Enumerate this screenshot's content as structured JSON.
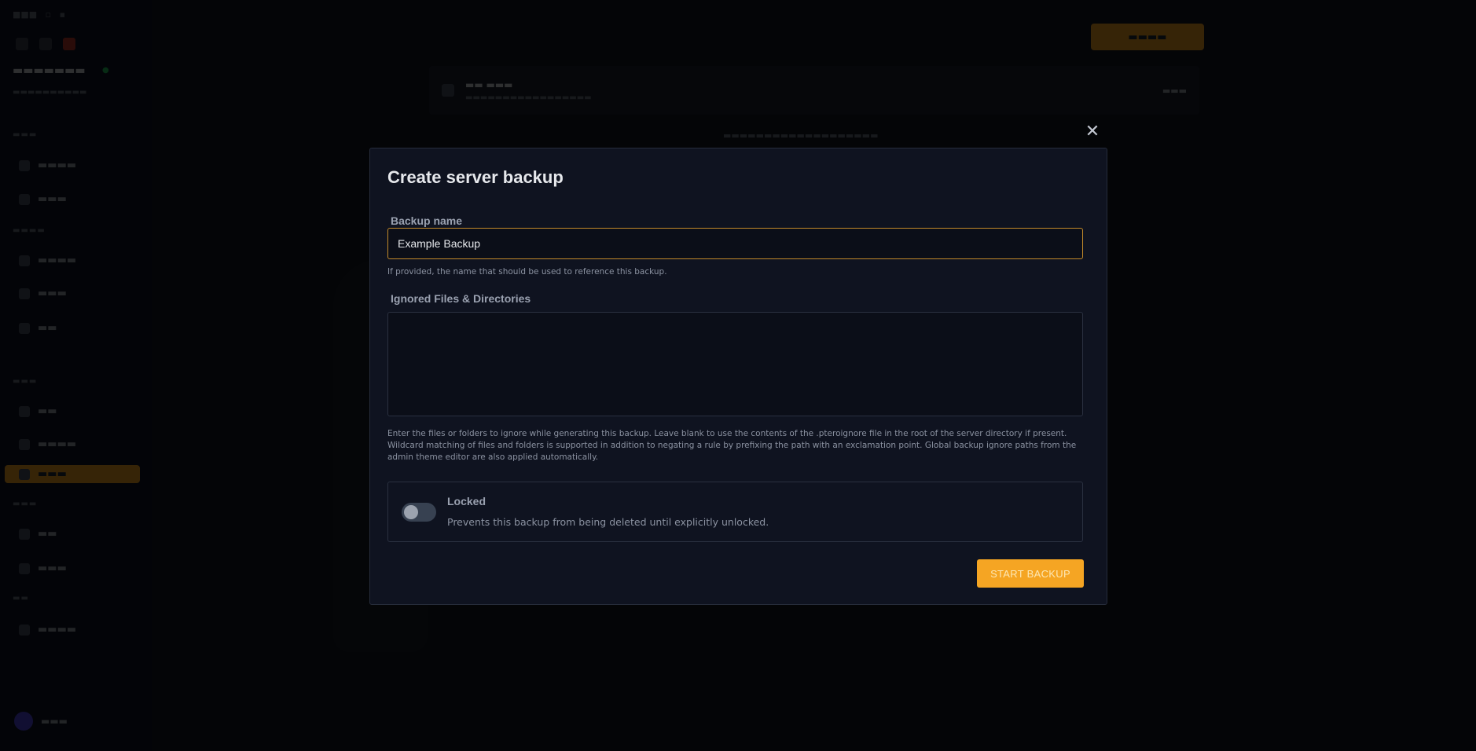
{
  "modal": {
    "title": "Create server backup",
    "close_glyph": "✕",
    "backup_name": {
      "label": "Backup name",
      "value": "Example Backup",
      "help": "If provided, the name that should be used to reference this backup."
    },
    "ignored": {
      "label": "Ignored Files & Directories",
      "value": "",
      "help": "Enter the files or folders to ignore while generating this backup. Leave blank to use the contents of the .pteroignore file in the root of the server directory if present. Wildcard matching of files and folders is supported in addition to negating a rule by prefixing the path with an exclamation point. Global backup ignore paths from the admin theme editor are also applied automatically."
    },
    "locked": {
      "title": "Locked",
      "description": "Prevents this backup from being deleted until explicitly unlocked.",
      "enabled": false
    },
    "submit_label": "START BACKUP"
  },
  "colors": {
    "accent": "#f5a523",
    "modal_bg": "#0f1320",
    "input_border_focus": "#c2892a"
  }
}
